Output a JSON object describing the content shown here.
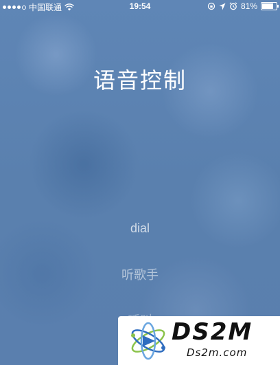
{
  "status_bar": {
    "carrier": "中国联通",
    "time": "19:54",
    "battery_percent": "81%",
    "battery_level": 0.81,
    "signal_bars": 4,
    "signal_max": 5,
    "icons": [
      "wifi-icon",
      "rotation-lock-icon",
      "location-icon",
      "alarm-icon",
      "battery-icon"
    ]
  },
  "main": {
    "title": "语音控制",
    "suggestions": [
      "dial",
      "听歌手",
      "呼叫"
    ]
  },
  "watermark": {
    "brand": "DS2M",
    "domain": "Ds2m.com"
  },
  "colors": {
    "background": "#5a80ae",
    "text": "#ffffff"
  }
}
